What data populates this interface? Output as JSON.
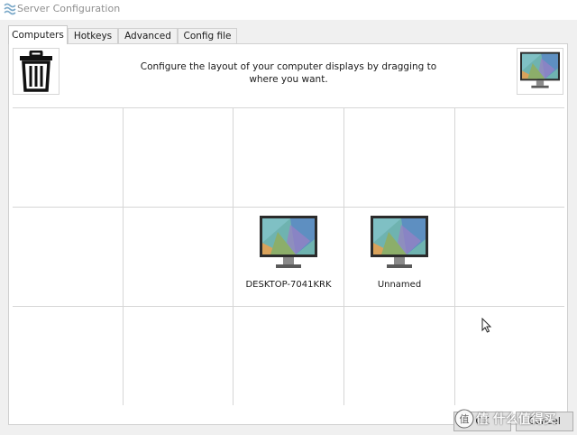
{
  "window": {
    "title": "Server Configuration",
    "icon": "synergy-waves-icon"
  },
  "tabs": [
    {
      "label": "Computers",
      "active": true
    },
    {
      "label": "Hotkeys",
      "active": false
    },
    {
      "label": "Advanced",
      "active": false
    },
    {
      "label": "Config file",
      "active": false
    }
  ],
  "computers_panel": {
    "instructions": "Configure the layout of your computer displays by dragging to where you want.",
    "trash_icon": "trash-icon",
    "new_screen_icon": "monitor-icon",
    "grid": {
      "columns": 5,
      "rows": 3
    },
    "screens": [
      {
        "name": "DESKTOP-7041KRK",
        "row": 1,
        "column": 2
      },
      {
        "name": "Unnamed",
        "row": 1,
        "column": 3
      }
    ]
  },
  "buttons": {
    "ok_label": "OK",
    "cancel_label": "Cancel"
  },
  "watermark": {
    "text": "值 什么值得买"
  },
  "colors": {
    "panel_background": "#ffffff",
    "dialog_background": "#f0f0f0",
    "grid_line": "#d6d6d6",
    "monitor_bezel": "#2b2b2b"
  }
}
